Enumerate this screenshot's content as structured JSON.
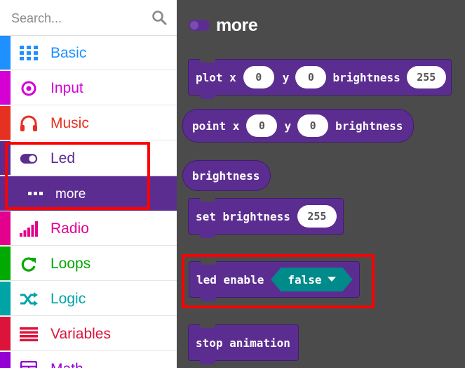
{
  "search": {
    "placeholder": "Search..."
  },
  "categories": [
    {
      "label": "Basic",
      "color": "#1e90ff",
      "icon": "grid-icon"
    },
    {
      "label": "Input",
      "color": "#d400d4",
      "icon": "target-icon"
    },
    {
      "label": "Music",
      "color": "#e63022",
      "icon": "headphones-icon"
    },
    {
      "label": "Led",
      "color": "#5c2d91",
      "icon": "toggle-icon"
    },
    {
      "label": "more",
      "color": "#5c2d91",
      "icon": "ellipsis-icon"
    },
    {
      "label": "Radio",
      "color": "#e3008c",
      "icon": "signal-bars-icon"
    },
    {
      "label": "Loops",
      "color": "#00aa00",
      "icon": "refresh-icon"
    },
    {
      "label": "Logic",
      "color": "#00a4a6",
      "icon": "shuffle-icon"
    },
    {
      "label": "Variables",
      "color": "#dc143c",
      "icon": "list-icon"
    },
    {
      "label": "Math",
      "color": "#9400d3",
      "icon": "calculator-icon"
    }
  ],
  "flyout": {
    "title": "more",
    "blocks": {
      "plot": {
        "t1": "plot x",
        "x": "0",
        "t2": "y",
        "y": "0",
        "t3": "brightness",
        "b": "255"
      },
      "point": {
        "t1": "point x",
        "x": "0",
        "t2": "y",
        "y": "0",
        "t3": "brightness"
      },
      "brightness": {
        "t1": "brightness"
      },
      "set_brightness": {
        "t1": "set brightness",
        "b": "255"
      },
      "led_enable": {
        "t1": "led enable",
        "value": "false"
      },
      "stop_animation": {
        "t1": "stop animation"
      }
    }
  },
  "colors": {
    "led": "#5c2d91",
    "bool": "#008a8a",
    "highlight": "#ff0000",
    "workspace": "#4b4b4b"
  }
}
